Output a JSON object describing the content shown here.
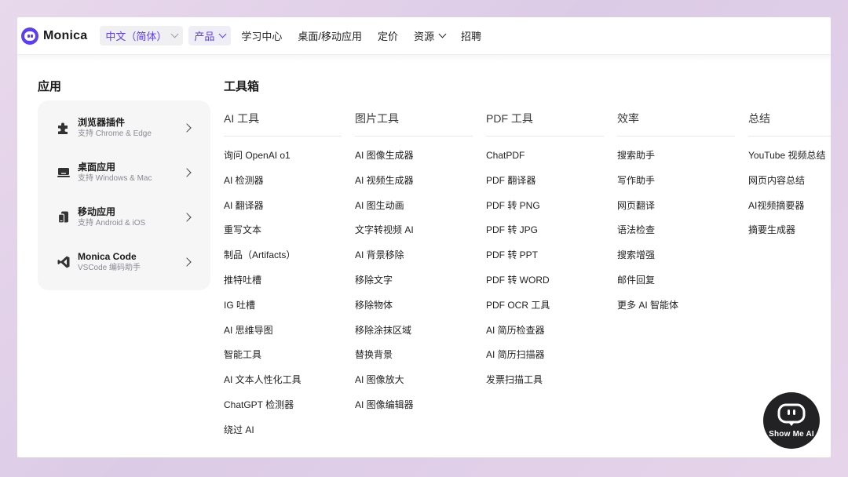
{
  "brand": {
    "name": "Monica"
  },
  "nav": {
    "language": "中文（简体）",
    "items": [
      "产品",
      "学习中心",
      "桌面/移动应用",
      "定价",
      "资源",
      "招聘"
    ]
  },
  "apps": {
    "title": "应用",
    "items": [
      {
        "name": "浏览器插件",
        "sub": "支持 Chrome & Edge",
        "icon": "puzzle-icon"
      },
      {
        "name": "桌面应用",
        "sub": "支持 Windows & Mac",
        "icon": "laptop-icon"
      },
      {
        "name": "移动应用",
        "sub": "支持 Android & iOS",
        "icon": "phone-icon"
      },
      {
        "name": "Monica Code",
        "sub": "VSCode 编码助手",
        "icon": "vscode-icon"
      }
    ]
  },
  "tools": {
    "title": "工具箱",
    "columns": [
      {
        "head": "AI 工具",
        "items": [
          "询问 OpenAI o1",
          "AI 检测器",
          "AI 翻译器",
          "重写文本",
          "制品（Artifacts）",
          "推特吐槽",
          "IG 吐槽",
          "AI 思维导图",
          "智能工具",
          "AI 文本人性化工具",
          "ChatGPT 检测器",
          "绕过 AI"
        ]
      },
      {
        "head": "图片工具",
        "items": [
          "AI 图像生成器",
          "AI 视频生成器",
          "AI 图生动画",
          "文字转视频 AI",
          "AI 背景移除",
          "移除文字",
          "移除物体",
          "移除涂抹区域",
          "替换背景",
          "AI 图像放大",
          "AI 图像编辑器"
        ]
      },
      {
        "head": "PDF 工具",
        "items": [
          "ChatPDF",
          "PDF 翻译器",
          "PDF 转 PNG",
          "PDF 转 JPG",
          "PDF 转 PPT",
          "PDF 转 WORD",
          "PDF OCR 工具",
          "AI 简历检查器",
          "AI 简历扫描器",
          "发票扫描工具"
        ]
      },
      {
        "head": "效率",
        "items": [
          "搜索助手",
          "写作助手",
          "网页翻译",
          "语法检查",
          "搜索增强",
          "邮件回复",
          "更多 AI 智能体"
        ]
      },
      {
        "head": "总结",
        "items": [
          "YouTube 视频总结",
          "网页内容总结",
          "AI视频摘要器",
          "摘要生成器"
        ]
      }
    ]
  },
  "badge": {
    "text": "Show Me AI"
  },
  "colors": {
    "accent": "#5b3df5",
    "badge_bg": "#222225"
  }
}
